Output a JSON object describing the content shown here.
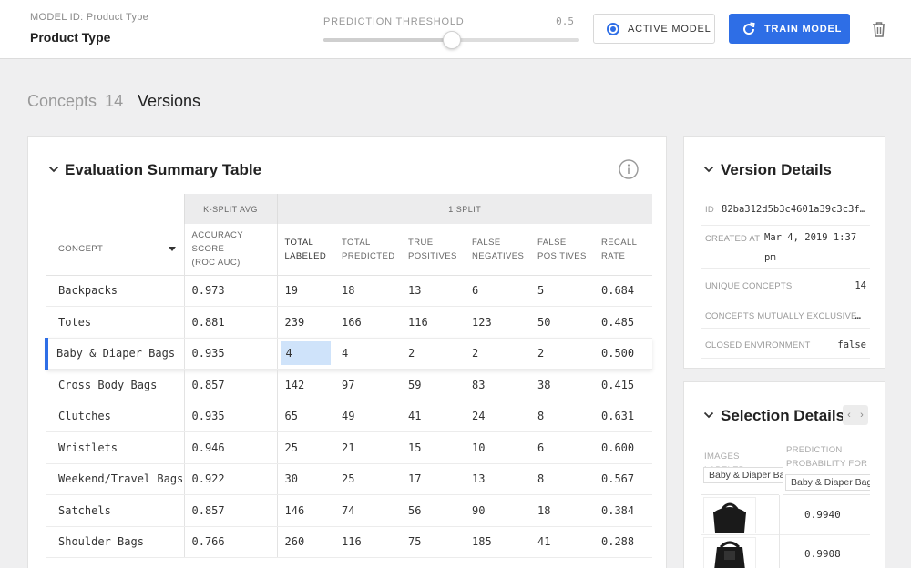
{
  "header": {
    "model_id_label": "MODEL ID: Product Type",
    "model_name": "Product Type",
    "threshold_label": "PREDICTION THRESHOLD",
    "threshold_value": "0.5",
    "threshold_fraction": 0.5,
    "active_model_label": "ACTIVE MODEL",
    "train_model_label": "TRAIN MODEL"
  },
  "tabs": {
    "concepts_label": "Concepts",
    "concepts_count": "14",
    "versions_label": "Versions"
  },
  "evaluation": {
    "title": "Evaluation Summary Table",
    "group_headers": {
      "ksplit": "K-SPLIT AVG",
      "split": "1 SPLIT"
    },
    "columns": {
      "concept": "CONCEPT",
      "accuracy_1": "ACCURACY SCORE",
      "accuracy_2": "(ROC AUC)",
      "total_labeled_1": "TOTAL",
      "total_labeled_2": "LABELED",
      "total_predicted_1": "TOTAL",
      "total_predicted_2": "PREDICTED",
      "true_pos_1": "TRUE",
      "true_pos_2": "POSITIVES",
      "false_neg_1": "FALSE",
      "false_neg_2": "NEGATIVES",
      "false_pos_1": "FALSE",
      "false_pos_2": "POSITIVES",
      "recall_1": "RECALL",
      "recall_2": "RATE"
    },
    "rows": [
      {
        "concept": "Backpacks",
        "accuracy": "0.973",
        "total_labeled": "19",
        "total_predicted": "18",
        "true_positives": "13",
        "false_negatives": "6",
        "false_positives": "5",
        "recall_rate": "0.684"
      },
      {
        "concept": "Totes",
        "accuracy": "0.881",
        "total_labeled": "239",
        "total_predicted": "166",
        "true_positives": "116",
        "false_negatives": "123",
        "false_positives": "50",
        "recall_rate": "0.485"
      },
      {
        "concept": "Baby & Diaper Bags",
        "accuracy": "0.935",
        "total_labeled": "4",
        "total_predicted": "4",
        "true_positives": "2",
        "false_negatives": "2",
        "false_positives": "2",
        "recall_rate": "0.500"
      },
      {
        "concept": "Cross Body Bags",
        "accuracy": "0.857",
        "total_labeled": "142",
        "total_predicted": "97",
        "true_positives": "59",
        "false_negatives": "83",
        "false_positives": "38",
        "recall_rate": "0.415"
      },
      {
        "concept": "Clutches",
        "accuracy": "0.935",
        "total_labeled": "65",
        "total_predicted": "49",
        "true_positives": "41",
        "false_negatives": "24",
        "false_positives": "8",
        "recall_rate": "0.631"
      },
      {
        "concept": "Wristlets",
        "accuracy": "0.946",
        "total_labeled": "25",
        "total_predicted": "21",
        "true_positives": "15",
        "false_negatives": "10",
        "false_positives": "6",
        "recall_rate": "0.600"
      },
      {
        "concept": "Weekend/Travel Bags",
        "accuracy": "0.922",
        "total_labeled": "30",
        "total_predicted": "25",
        "true_positives": "17",
        "false_negatives": "13",
        "false_positives": "8",
        "recall_rate": "0.567"
      },
      {
        "concept": "Satchels",
        "accuracy": "0.857",
        "total_labeled": "146",
        "total_predicted": "74",
        "true_positives": "56",
        "false_negatives": "90",
        "false_positives": "18",
        "recall_rate": "0.384"
      },
      {
        "concept": "Shoulder Bags",
        "accuracy": "0.766",
        "total_labeled": "260",
        "total_predicted": "116",
        "true_positives": "75",
        "false_negatives": "185",
        "false_positives": "41",
        "recall_rate": "0.288"
      }
    ]
  },
  "version_details": {
    "title": "Version Details",
    "id_label": "ID",
    "id_value": "82ba312d5b3c4601a39c3c3f…",
    "created_label": "CREATED AT",
    "created_value_1": "Mar 4, 2019 1:37",
    "created_value_2": "pm",
    "unique_label": "UNIQUE CONCEPTS",
    "unique_value": "14",
    "exclusive_label": "CONCEPTS MUTUALLY EXCLUSIVE",
    "exclusive_value": "…",
    "closed_label": "CLOSED ENVIRONMENT",
    "closed_value": "false"
  },
  "selection_details": {
    "title": "Selection Details",
    "images_labeled_label": "IMAGES LABELED",
    "images_labeled_tag": "Baby & Diaper Bags",
    "pred_prob_label_1": "PREDICTION",
    "pred_prob_label_2": "PROBABILITY FOR",
    "pred_prob_tag": "Baby & Diaper Bag",
    "probabilities": [
      "0.9940",
      "0.9908"
    ]
  },
  "colors": {
    "accent": "#2e6ee6",
    "highlight": "#cfe3fa"
  }
}
